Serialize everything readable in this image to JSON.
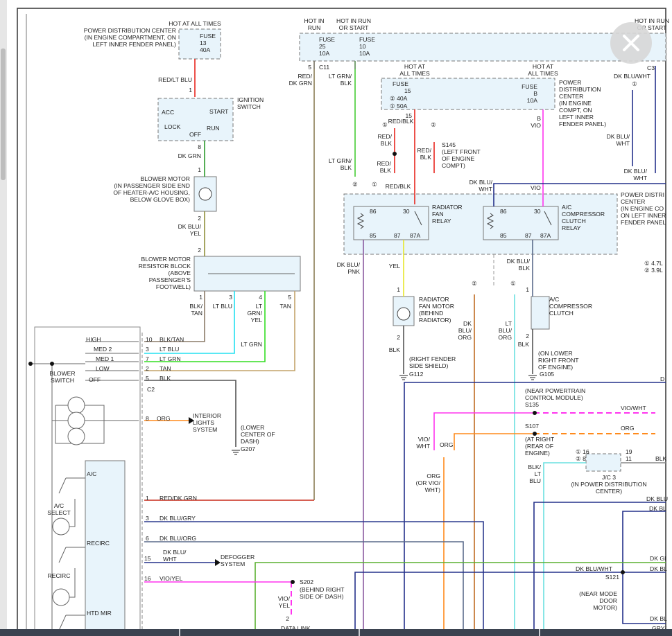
{
  "viewer": {
    "close_label": "Close"
  },
  "wire_colors": {
    "red": "#e8241c",
    "dk_grn": "#2c9a2c",
    "dk_blu_yel": "#8f8f3a",
    "blk_tan": "#8b7b68",
    "lt_blu": "#22e0f0",
    "lt_grn": "#33dd22",
    "tan": "#c3a36a",
    "blk": "#555555",
    "org": "#ff8a1c",
    "red_dk_grn": "#c82a18",
    "olive": "#8a7d55",
    "lt_grn_blk": "#44cc33",
    "vio": "#ff33ee",
    "dk_blu": "#24308a",
    "dk_blu_pnk": "#8a5aa0",
    "yel": "#e6e62a",
    "dk_blu_org": "#c06a20",
    "dk_blu_gry": "#2c3a8e",
    "dk_blu_blk": "#5a6a8a",
    "green": "#5ab030",
    "cyan": "#6ae0e0",
    "gray": "#888888",
    "box_fill": "#e8f4fb"
  },
  "labels": {
    "hot_all_1": "HOT AT ALL TIMES",
    "pdc_1": "POWER DISTRIBUTION CENTER\n(IN ENGINE COMPARTMENT, ON\nLEFT INNER FENDER PANEL)",
    "fuse13": "FUSE\n13\n40A",
    "red_lt_blu": "RED/LT BLU",
    "pin_ign_1": "1",
    "ign_switch": "IGNITION\nSWITCH",
    "ign_acc": "ACC",
    "ign_start": "START",
    "ign_lock": "LOCK",
    "ign_run": "RUN",
    "ign_off": "OFF",
    "pin_ign_8": "8",
    "dk_grn": "DK GRN",
    "pin_bm_1": "1",
    "blower_motor": "BLOWER MOTOR\n(IN PASSENGER SIDE END\nOF HEATER-A/C HOUSING,\nBELOW GLOVE BOX)",
    "pin_bm_2": "2",
    "dk_blu_yel": "DK BLU/\nYEL",
    "pin_rb_2": "2",
    "resistor_block": "BLOWER MOTOR\nRESISTOR BLOCK\n(ABOVE\nPASSENGER'S\nFOOTWELL)",
    "rb_pin1": "1",
    "rb_pin3": "3",
    "rb_pin4": "4",
    "rb_pin5": "5",
    "rb_blk_tan": "BLK/\nTAN",
    "rb_lt_blu": "LT BLU",
    "rb_lt_grn_yel": "LT\nGRN/\nYEL",
    "rb_tan": "TAN",
    "lt_grn_splice": "LT GRN",
    "sw_high": "HIGH",
    "sw_med2": "MED 2",
    "sw_med1": "MED 1",
    "sw_low": "LOW",
    "sw_off": "OFF",
    "blower_switch": "BLOWER\nSWITCH",
    "c2_10": "10",
    "c2_blk_tan": "BLK/TAN",
    "c2_3": "3",
    "c2_lt_blu": "LT BLU",
    "c2_7": "7",
    "c2_lt_grn": "LT GRN",
    "c2_2": "2",
    "c2_tan": "TAN",
    "c2_5": "5",
    "c2_blk": "BLK",
    "c2": "C2",
    "c2_8": "8",
    "c2_org": "ORG",
    "interior_lights": "INTERIOR\nLIGHTS\nSYSTEM",
    "g207_loc": "(LOWER\nCENTER OF\nDASH)",
    "g207": "G207",
    "mod_ac": "A/C",
    "ac_select": "A/C\nSELECT",
    "mod_recirc": "RECIRC",
    "recirc": "RECIRC",
    "mod_htd_mir": "HTD MIR",
    "p1": "1",
    "red_dk_grn": "RED/DK GRN",
    "p3": "3",
    "dk_blu_gry": "DK BLU/GRY",
    "p6": "6",
    "dk_blu_org_l": "DK BLU/ORG",
    "p15": "15",
    "dk_blu_wht_l": "DK BLU/\nWHT",
    "defogger": "DEFOGGER\nSYSTEM",
    "p16": "16",
    "vio_yel": "VIO/YEL",
    "s202": "S202",
    "s202_loc": "(BEHIND RIGHT\nSIDE OF DASH)",
    "vio_yel_2": "VIO/\nYEL",
    "dl_pin2": "2",
    "data_link": "DATA LINK",
    "hot_run": "HOT IN\nRUN",
    "hot_run_start": "HOT IN RUN\nOR START",
    "fuse25": "FUSE\n25\n10A",
    "fuse10": "FUSE\n10\n10A",
    "c11_5": "5",
    "c11": "C11",
    "red_dk_grn_2": "RED/\nDK GRN",
    "lt_grn_blk": "LT GRN/\nBLK",
    "hot_all_2": "HOT AT\nALL TIMES",
    "fuse15": "FUSE",
    "fuse15_num": "15",
    "fuse15_a": "② 40A",
    "fuse15_b": "① 50A",
    "pin15": "15",
    "red_blk_top": "RED/BLK",
    "c_1a": "①",
    "c_2a": "②",
    "red_blk_l": "RED/\nBLK",
    "s145": "S145\n(LEFT FRONT\nOF ENGINE\nCOMPT)",
    "red_blk_r": "RED/\nBLK",
    "red_blk_m": "RED/\nBLK",
    "lt_grn_blk_2": "LT GRN/\nBLK",
    "c_2b": "②",
    "c_1b": "①",
    "red_blk_bot": "RED/BLK",
    "hot_all_3": "HOT AT\nALL TIMES",
    "fuse_b": "FUSE\nB\n10A",
    "pdc_2": "POWER\nDISTRIBUTION\nCENTER\n(IN ENGINE\nCOMPT, ON\nLEFT INNER\nFENDER PANEL)",
    "b_vio": "B\nVIO",
    "dk_blu_wht_r": "DK BLU/\nWHT",
    "vio_r": "VIO",
    "rad_relay": "RADIATOR\nFAN\nRELAY",
    "ac_relay": "A/C\nCOMPRESSOR\nCLUTCH\nRELAY",
    "r1_86": "86",
    "r1_30": "30",
    "r1_85": "85",
    "r1_87": "87",
    "r1_87a": "87A",
    "r2_86": "86",
    "r2_30": "30",
    "r2_85": "85",
    "r2_87": "87",
    "r2_87a": "87A",
    "pdc_3": "POWER DISTRI\nCENTER\n(IN ENGINE CO\nON LEFT INNER\nFENDER PANEL",
    "dk_blu_pnk": "DK BLU/\nPNK",
    "yel": "YEL",
    "dk_blu_blk": "DK BLU/\nBLK",
    "engine_note": "① 4.7L\n② 3.9L",
    "c_2c": "②",
    "c_1c": "①",
    "fm_1": "1",
    "rad_fan_motor": "RADIATOR\nFAN MOTOR\n(BEHIND\nRADIATOR)",
    "fm_2": "2",
    "fm_blk": "BLK",
    "g112_loc": "(RIGHT FENDER\nSIDE SHIELD)",
    "g112": "G112",
    "cl_1": "1",
    "ac_clutch": "A/C\nCOMPRESSOR\nCLUTCH",
    "cl_2": "2",
    "cl_blk": "BLK",
    "g105_loc": "(ON LOWER\nRIGHT FRONT\nOF ENGINE)",
    "g105": "G105",
    "dk_blu_org_v": "DK\nBLU/\nORG",
    "lt_blu_org_v": "LT\nBLU/\nORG",
    "s135": "(NEAR POWERTRAIN\nCONTROL MODULE)\nS135",
    "vio_wht": "VIO/WHT",
    "s107": "S107",
    "org_r": "ORG",
    "s107_loc": "(AT RIGHT\n(REAR OF\nENGINE)",
    "vio_wht_2": "VIO/\nWHT",
    "org_2": "ORG",
    "org_or": "ORG\n(OR VIO/\nWHT)",
    "blk_lt_blu": "BLK/\nLT\nBLU",
    "jc3_pins_l": "① 16\n② 8",
    "jc3_pins_r": "19\n11",
    "jc3": "J/C 3\n(IN POWER DISTRIBUTION\nCENTER)",
    "blk_r": "BLK",
    "dk_bl_1": "DK BLU",
    "dk_bl_2": "DK BL",
    "dk_gr": "DK GI",
    "dk_blu_wht_s": "DK BLU/WHT",
    "dk_bl_3": "DK BL",
    "s121": "S121",
    "s121_loc": "(NEAR MODE\nDOOR\nMOTOR)",
    "dk_bl_4": "DK BL",
    "gry": "GRY/",
    "hot_run_start_r": "HOT IN RUN\nOR START",
    "c3": "C3",
    "dk_blu_wht_tr": "DK BLU/WHT",
    "c_1d": "①",
    "dk_blu_wht_tr2": "DK BLU/\nWHT",
    "dk_blu_wht_tr3": "DK BLU/\nWHT",
    "d_edge": "D"
  }
}
